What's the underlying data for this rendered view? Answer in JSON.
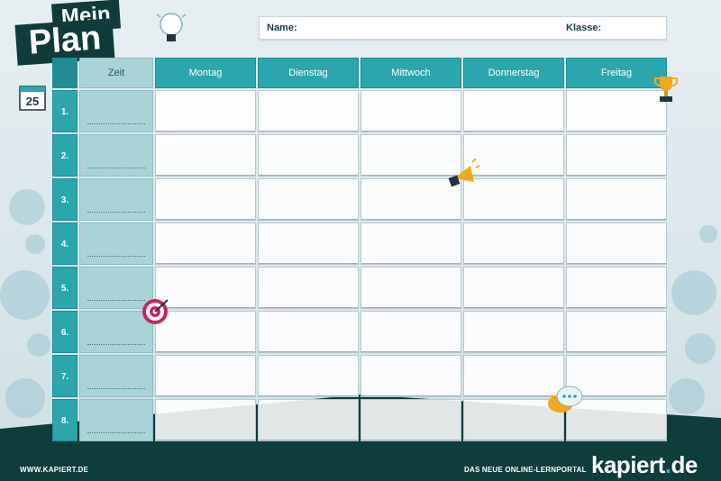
{
  "title": {
    "mein": "Mein",
    "plan": "Plan"
  },
  "calendar_day": "25",
  "form": {
    "name_label": "Name:",
    "klasse_label": "Klasse:"
  },
  "table": {
    "zeit_header": "Zeit",
    "days": [
      "Montag",
      "Dienstag",
      "Mittwoch",
      "Donnerstag",
      "Freitag"
    ],
    "periods": [
      "1.",
      "2.",
      "3.",
      "4.",
      "5.",
      "6.",
      "7.",
      "8."
    ]
  },
  "footer": {
    "website": "WWW.KAPIERT.DE",
    "tagline": "DAS NEUE ONLINE-LERNPORTAL",
    "brand_main": "kapiert",
    "brand_suffix": "de"
  },
  "colors": {
    "teal": "#2ba6ad",
    "dark": "#103b3a",
    "light_teal": "#a9d3d6"
  },
  "icons": [
    "lightbulb-icon",
    "calendar-icon",
    "trophy-icon",
    "megaphone-icon",
    "target-icon",
    "chat-bubbles-icon"
  ]
}
